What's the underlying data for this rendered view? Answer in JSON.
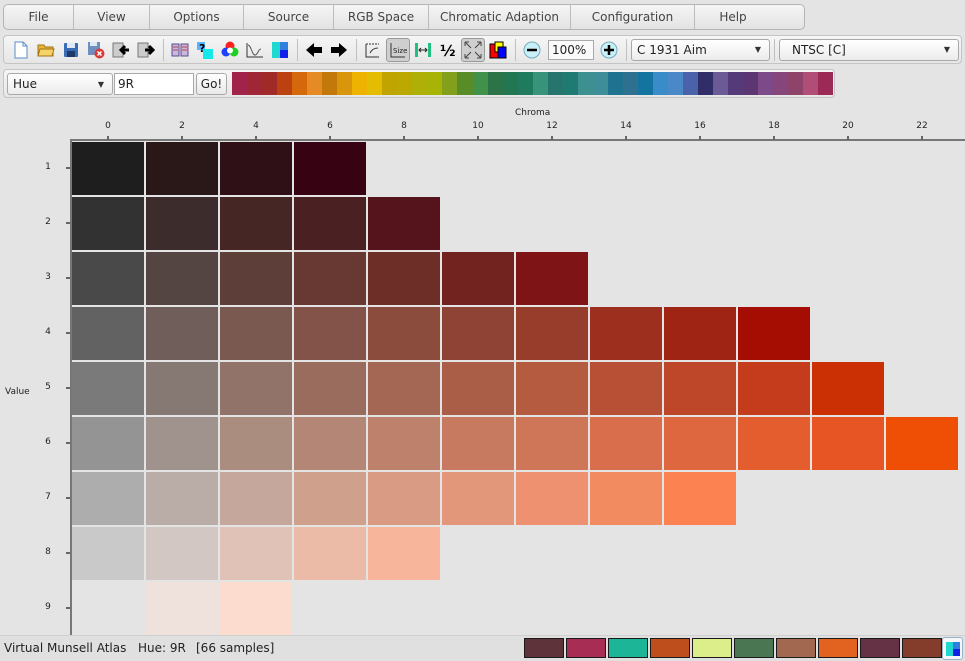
{
  "menu": {
    "items": [
      {
        "label": "File",
        "w": 1
      },
      {
        "label": "View",
        "w": 1
      },
      {
        "label": "Options",
        "w": 1
      },
      {
        "label": "Source",
        "w": 1
      },
      {
        "label": "RGB Space",
        "w": 1
      },
      {
        "label": "Chromatic Adaption",
        "w": 1
      },
      {
        "label": "Configuration",
        "w": 1
      },
      {
        "label": "Help",
        "w": 1
      }
    ]
  },
  "toolbar": {
    "buttons": [
      {
        "name": "new-document-icon"
      },
      {
        "name": "open-folder-icon"
      },
      {
        "name": "save-icon"
      },
      {
        "name": "delete-file-icon"
      },
      {
        "name": "import-icon"
      },
      {
        "name": "export-icon"
      },
      {
        "name": "book-icon"
      },
      {
        "name": "identify-color-icon"
      },
      {
        "name": "color-wheel-icon"
      },
      {
        "name": "spectrum-graph-icon"
      },
      {
        "name": "color-tiles-icon"
      },
      {
        "name": "arrow-left-icon"
      },
      {
        "name": "arrow-right-icon"
      },
      {
        "name": "swap-axes-icon"
      },
      {
        "name": "size-icon"
      },
      {
        "name": "spacing-icon"
      },
      {
        "name": "half-icon"
      },
      {
        "name": "fit-screen-icon"
      },
      {
        "name": "overlap-icon"
      }
    ],
    "zoom_value": "100%",
    "zoom_out_icon": "minus-circle-icon",
    "zoom_in_icon": "plus-circle-icon",
    "illuminant_select": "C 1931 Aim",
    "rgb_space_select": "NTSC [C]"
  },
  "huebar": {
    "mode_select": "Hue",
    "hue_input": "9R",
    "go_label": "Go!",
    "swatches": [
      "#a0234a",
      "#a02536",
      "#a02a27",
      "#bb4210",
      "#d4680a",
      "#e68a25",
      "#c2790a",
      "#da960b",
      "#eeb300",
      "#e4bc00",
      "#c0a500",
      "#bba900",
      "#aeb008",
      "#a7b305",
      "#83a01d",
      "#588c26",
      "#42914a",
      "#2c7448",
      "#237652",
      "#1f7a5e",
      "#37947a",
      "#25756c",
      "#1f7a72",
      "#3c9090",
      "#3d8e98",
      "#1f7390",
      "#2d7090",
      "#1474a0",
      "#3a8cc8",
      "#4b88c8",
      "#4a62aa",
      "#302d68",
      "#6a5a96",
      "#553a7a",
      "#5c3672",
      "#7c4a88",
      "#86467c",
      "#8e446a",
      "#b04e78",
      "#9c2a56"
    ]
  },
  "status": {
    "app_name": "Virtual Munsell Atlas",
    "hue_text": "Hue: 9R",
    "samples_text": "[66 samples]",
    "history_swatches": [
      "#5e333a",
      "#a82d54",
      "#1db598",
      "#be4e1c",
      "#dbee8a",
      "#4a7752",
      "#a36850",
      "#e2621f",
      "#643244",
      "#843d2a"
    ],
    "history_icon": "color-tiles-icon"
  },
  "chart_data": {
    "type": "heatmap",
    "title": "Hue 9R",
    "xlabel": "Chroma",
    "ylabel": "Value",
    "x_ticks": [
      0,
      2,
      4,
      6,
      8,
      10,
      12,
      14,
      16,
      18,
      20,
      22
    ],
    "y_ticks": [
      1,
      2,
      3,
      4,
      5,
      6,
      7,
      8,
      9
    ],
    "xlim": [
      0,
      22
    ],
    "ylim": [
      1,
      9
    ],
    "grid": false,
    "rows": [
      {
        "value": 1,
        "cells": [
          {
            "chroma": 0,
            "color": "#1e1e1e"
          },
          {
            "chroma": 2,
            "color": "#2a1819"
          },
          {
            "chroma": 4,
            "color": "#301017"
          },
          {
            "chroma": 6,
            "color": "#370313"
          }
        ]
      },
      {
        "value": 2,
        "cells": [
          {
            "chroma": 0,
            "color": "#323232"
          },
          {
            "chroma": 2,
            "color": "#3c2c2c"
          },
          {
            "chroma": 4,
            "color": "#452624"
          },
          {
            "chroma": 6,
            "color": "#4a2023"
          },
          {
            "chroma": 8,
            "color": "#55141b"
          }
        ]
      },
      {
        "value": 3,
        "cells": [
          {
            "chroma": 0,
            "color": "#494949"
          },
          {
            "chroma": 2,
            "color": "#554542"
          },
          {
            "chroma": 4,
            "color": "#5e3e38"
          },
          {
            "chroma": 6,
            "color": "#683832"
          },
          {
            "chroma": 8,
            "color": "#6e2e28"
          },
          {
            "chroma": 10,
            "color": "#73231f"
          },
          {
            "chroma": 12,
            "color": "#7e1416"
          }
        ]
      },
      {
        "value": 4,
        "cells": [
          {
            "chroma": 0,
            "color": "#626262"
          },
          {
            "chroma": 2,
            "color": "#6f5e5a"
          },
          {
            "chroma": 4,
            "color": "#7a5a50"
          },
          {
            "chroma": 6,
            "color": "#835349"
          },
          {
            "chroma": 8,
            "color": "#8b4c3e"
          },
          {
            "chroma": 10,
            "color": "#8e4334"
          },
          {
            "chroma": 12,
            "color": "#983d2c"
          },
          {
            "chroma": 14,
            "color": "#9c2f1e"
          },
          {
            "chroma": 16,
            "color": "#a02414"
          },
          {
            "chroma": 18,
            "color": "#a60d02"
          }
        ]
      },
      {
        "value": 5,
        "cells": [
          {
            "chroma": 0,
            "color": "#7a7a7a"
          },
          {
            "chroma": 2,
            "color": "#867873"
          },
          {
            "chroma": 4,
            "color": "#917369"
          },
          {
            "chroma": 6,
            "color": "#9a6c5e"
          },
          {
            "chroma": 8,
            "color": "#a36753"
          },
          {
            "chroma": 10,
            "color": "#ab5e47"
          },
          {
            "chroma": 12,
            "color": "#b45b40"
          },
          {
            "chroma": 14,
            "color": "#b85036"
          },
          {
            "chroma": 16,
            "color": "#bf4729"
          },
          {
            "chroma": 18,
            "color": "#c43c1b"
          },
          {
            "chroma": 20,
            "color": "#cb3004"
          }
        ]
      },
      {
        "value": 6,
        "cells": [
          {
            "chroma": 0,
            "color": "#949494"
          },
          {
            "chroma": 2,
            "color": "#a0928c"
          },
          {
            "chroma": 4,
            "color": "#ab8d80"
          },
          {
            "chroma": 6,
            "color": "#b48675"
          },
          {
            "chroma": 8,
            "color": "#be816b"
          },
          {
            "chroma": 10,
            "color": "#c87a60"
          },
          {
            "chroma": 12,
            "color": "#cf7558"
          },
          {
            "chroma": 14,
            "color": "#d86e4b"
          },
          {
            "chroma": 16,
            "color": "#df673f"
          },
          {
            "chroma": 18,
            "color": "#e35d2e"
          },
          {
            "chroma": 20,
            "color": "#e85524"
          },
          {
            "chroma": 22,
            "color": "#ef4f04"
          }
        ]
      },
      {
        "value": 7,
        "cells": [
          {
            "chroma": 0,
            "color": "#adadad"
          },
          {
            "chroma": 2,
            "color": "#baaca7"
          },
          {
            "chroma": 4,
            "color": "#c5a79b"
          },
          {
            "chroma": 6,
            "color": "#cfa18d"
          },
          {
            "chroma": 8,
            "color": "#d99b84"
          },
          {
            "chroma": 10,
            "color": "#e3977a"
          },
          {
            "chroma": 12,
            "color": "#ed9170"
          },
          {
            "chroma": 14,
            "color": "#f38b60"
          },
          {
            "chroma": 16,
            "color": "#fc8252"
          }
        ]
      },
      {
        "value": 8,
        "cells": [
          {
            "chroma": 0,
            "color": "#c9c9c9"
          },
          {
            "chroma": 2,
            "color": "#d2c7c2"
          },
          {
            "chroma": 4,
            "color": "#e1c2b7"
          },
          {
            "chroma": 6,
            "color": "#ebbba8"
          },
          {
            "chroma": 8,
            "color": "#f7b69b"
          }
        ]
      },
      {
        "value": 9,
        "cells": [
          {
            "chroma": 2,
            "color": "#efe2dd"
          },
          {
            "chroma": 4,
            "color": "#fcdccf"
          }
        ]
      }
    ]
  }
}
